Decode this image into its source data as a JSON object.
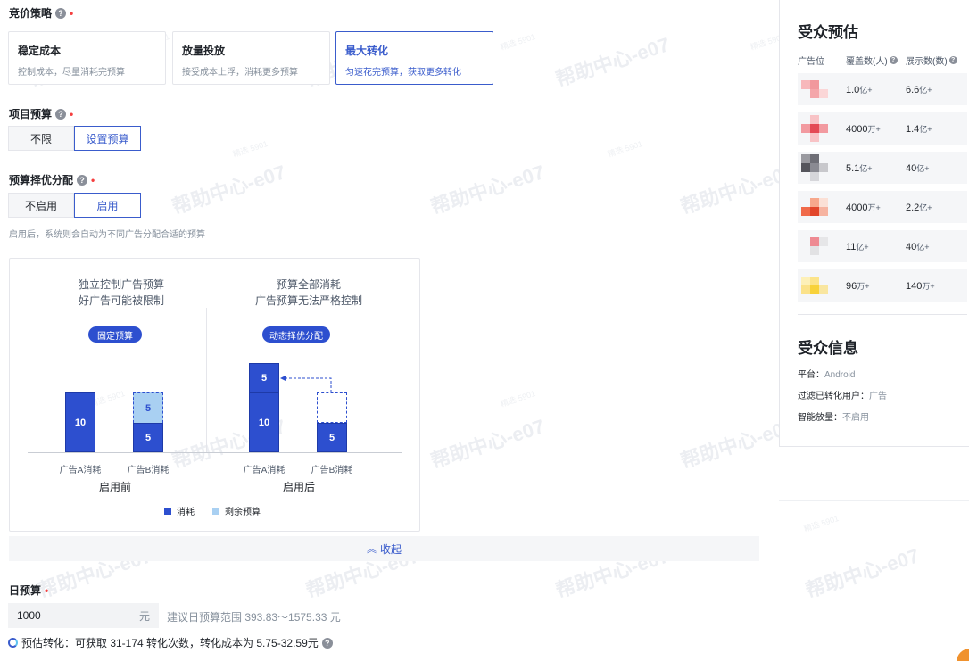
{
  "bid": {
    "title": "竞价策略",
    "cards": [
      {
        "title": "稳定成本",
        "desc": "控制成本，尽量消耗完预算"
      },
      {
        "title": "放量投放",
        "desc": "接受成本上浮，消耗更多预算"
      },
      {
        "title": "最大转化",
        "desc": "匀速花完预算，获取更多转化"
      }
    ]
  },
  "budget": {
    "title": "项目预算",
    "opt1": "不限",
    "opt2": "设置预算"
  },
  "alloc": {
    "title": "预算择优分配",
    "opt1": "不启用",
    "opt2": "启用",
    "desc": "启用后，系统则会自动为不同广告分配合适的预算"
  },
  "illustration": {
    "left_caption_1": "独立控制广告预算",
    "left_caption_2": "好广告可能被限制",
    "right_caption_1": "预算全部消耗",
    "right_caption_2": "广告预算无法严格控制",
    "left_pill": "固定预算",
    "right_pill": "动态择优分配",
    "before": {
      "a_consume": "10",
      "b_remain": "5",
      "b_consume": "5"
    },
    "after": {
      "a_top": "5",
      "a_bottom": "10",
      "b_consume": "5"
    },
    "label_a": "广告A消耗",
    "label_b": "广告B消耗",
    "group_before": "启用前",
    "group_after": "启用后",
    "legend_consume": "消耗",
    "legend_remain": "剩余预算"
  },
  "collapse_label": "收起",
  "daily": {
    "title": "日预算",
    "value": "1000",
    "unit": "元",
    "hint": "建议日预算范围 393.83～1575.33 元",
    "estimate": "预估转化：可获取 31-174 转化次数，转化成本为 5.75-32.59元"
  },
  "audience": {
    "title": "受众预估",
    "headers": [
      "广告位",
      "覆盖数(人)",
      "展示数(数)"
    ],
    "rows": [
      {
        "cover_num": "1.0",
        "cover_unit": "亿+",
        "show_num": "6.6",
        "show_unit": "亿+"
      },
      {
        "cover_num": "4000",
        "cover_unit": "万+",
        "show_num": "1.4",
        "show_unit": "亿+"
      },
      {
        "cover_num": "5.1",
        "cover_unit": "亿+",
        "show_num": "40",
        "show_unit": "亿+"
      },
      {
        "cover_num": "4000",
        "cover_unit": "万+",
        "show_num": "2.2",
        "show_unit": "亿+"
      },
      {
        "cover_num": "11",
        "cover_unit": "亿+",
        "show_num": "40",
        "show_unit": "亿+"
      },
      {
        "cover_num": "96",
        "cover_unit": "万+",
        "show_num": "140",
        "show_unit": "万+"
      }
    ]
  },
  "info": {
    "title": "受众信息",
    "platform_label": "平台：",
    "platform_value": "Android",
    "filter_label": "过滤已转化用户：",
    "filter_value": "广告",
    "smart_label": "智能放量：",
    "smart_value": "不启用"
  },
  "colors": {
    "accent": "#3a5ccc",
    "consume": "#2d4fcf",
    "remain": "#a9d0f2",
    "required": "#f53f3f"
  }
}
